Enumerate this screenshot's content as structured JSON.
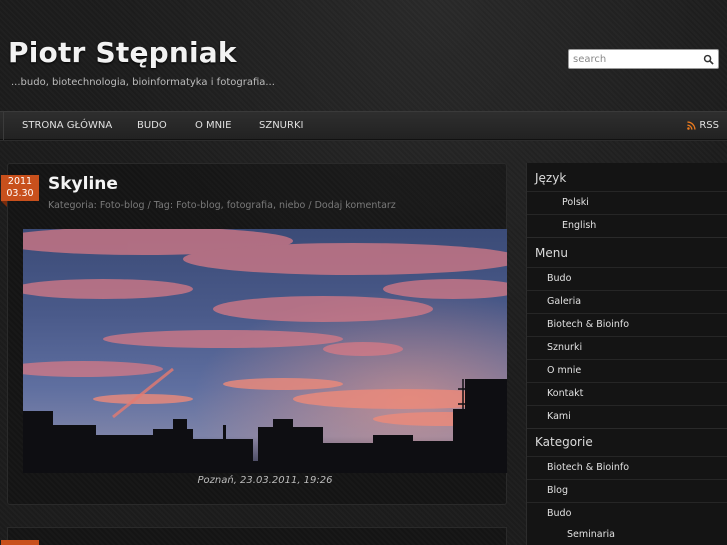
{
  "header": {
    "site_title": "Piotr Stępniak",
    "tagline": "...budo, biotechnologia, bioinformatyka i fotografia...",
    "search_placeholder": "search"
  },
  "nav": {
    "items": [
      "STRONA GŁÓWNA",
      "BUDO",
      "O MNIE",
      "SZNURKI"
    ],
    "rss_label": "RSS"
  },
  "post": {
    "date_year": "2011",
    "date_day": "03.30",
    "title": "Skyline",
    "meta_category_label": "Kategoria:",
    "meta_category": "Foto-blog",
    "meta_tag_label": "/ Tag:",
    "meta_tags": "Foto-blog, fotografia, niebo",
    "meta_comment": "/ Dodaj komentarz",
    "caption": "Poznań, 23.03.2011, 19:26"
  },
  "sidebar": {
    "language": {
      "title": "Język",
      "items": [
        "Polski",
        "English"
      ]
    },
    "menu": {
      "title": "Menu",
      "items": [
        "Budo",
        "Galeria",
        "Biotech & Bioinfo",
        "Sznurki",
        "O mnie",
        "Kontakt",
        "Kami"
      ]
    },
    "categories": {
      "title": "Kategorie",
      "items": [
        "Biotech & Bioinfo",
        "Blog",
        "Budo"
      ],
      "subitems": [
        "Seminaria"
      ]
    }
  },
  "colors": {
    "accent": "#c8501c",
    "background": "#1c1c1c",
    "rss": "#e8791e"
  },
  "icons": {
    "search": "search-icon",
    "rss": "rss-icon"
  }
}
